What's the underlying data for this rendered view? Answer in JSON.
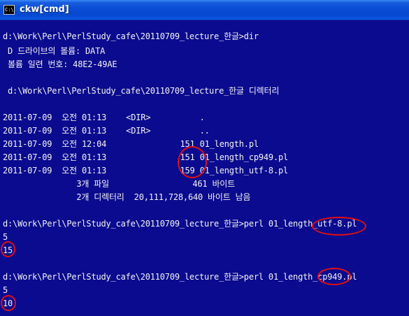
{
  "window": {
    "title": "ckw[cmd]",
    "icon": "console-icon",
    "icon_glyph": "C:\\"
  },
  "terminal": {
    "lines": [
      "d:\\Work\\Perl\\PerlStudy_cafe\\20110709_lecture_한글>dir",
      " D 드라이브의 볼륨: DATA",
      " 볼륨 일련 번호: 48E2-49AE",
      "",
      " d:\\Work\\Perl\\PerlStudy_cafe\\20110709_lecture_한글 디렉터리",
      "",
      "2011-07-09  오전 01:13    <DIR>          .",
      "2011-07-09  오전 01:13    <DIR>          ..",
      "2011-07-09  오전 12:04               151 01_length.pl",
      "2011-07-09  오전 01:13               151 01_length_cp949.pl",
      "2011-07-09  오전 01:13               159 01_length_utf-8.pl",
      "               3개 파일                 461 바이트",
      "               2개 디렉터리  20,111,728,640 바이트 남음",
      "",
      "d:\\Work\\Perl\\PerlStudy_cafe\\20110709_lecture_한글>perl 01_length_utf-8.pl",
      "5",
      "15",
      "",
      "d:\\Work\\Perl\\PerlStudy_cafe\\20110709_lecture_한글>perl 01_length_cp949.pl",
      "5",
      "10"
    ]
  },
  "colors": {
    "background": "#0b0b8f",
    "text": "#f2f2f2",
    "annotation": "#e01010",
    "titlebar": "#0a4fd6"
  }
}
